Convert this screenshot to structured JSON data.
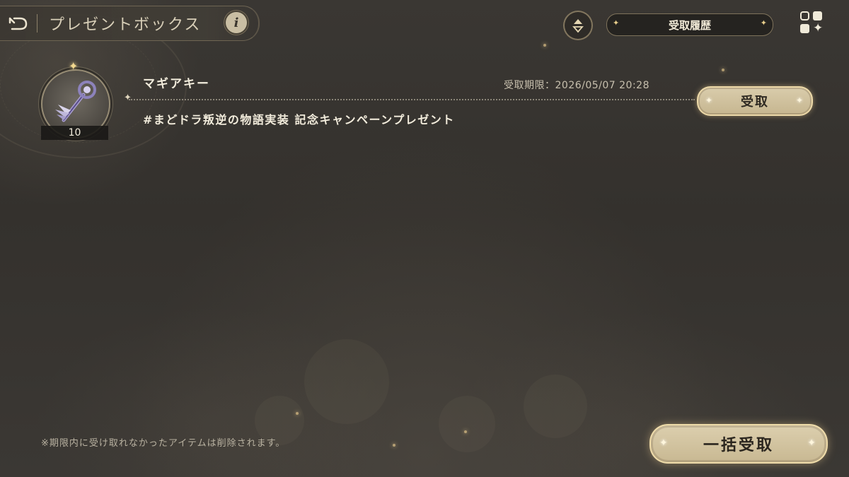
{
  "header": {
    "title": "プレゼントボックス",
    "info_label": "i",
    "history_label": "受取履歴"
  },
  "present": {
    "name": "マギアキー",
    "count": "10",
    "deadline": "受取期限：2026/05/07 20:28",
    "description": "#まどドラ叛逆の物語実装 記念キャンペーンプレゼント",
    "claim_label": "受取"
  },
  "footer": {
    "note": "※期限内に受け取れなかったアイテムは削除されます。",
    "claim_all_label": "一括受取"
  },
  "icons": {
    "back": "back-arrow-icon",
    "sort": "sort-icon",
    "menu": "grid-menu-icon",
    "item": "magia-key-icon"
  },
  "colors": {
    "accent_gold": "#d9ccab",
    "background": "#36332f",
    "text_light": "#f2ecdc"
  }
}
